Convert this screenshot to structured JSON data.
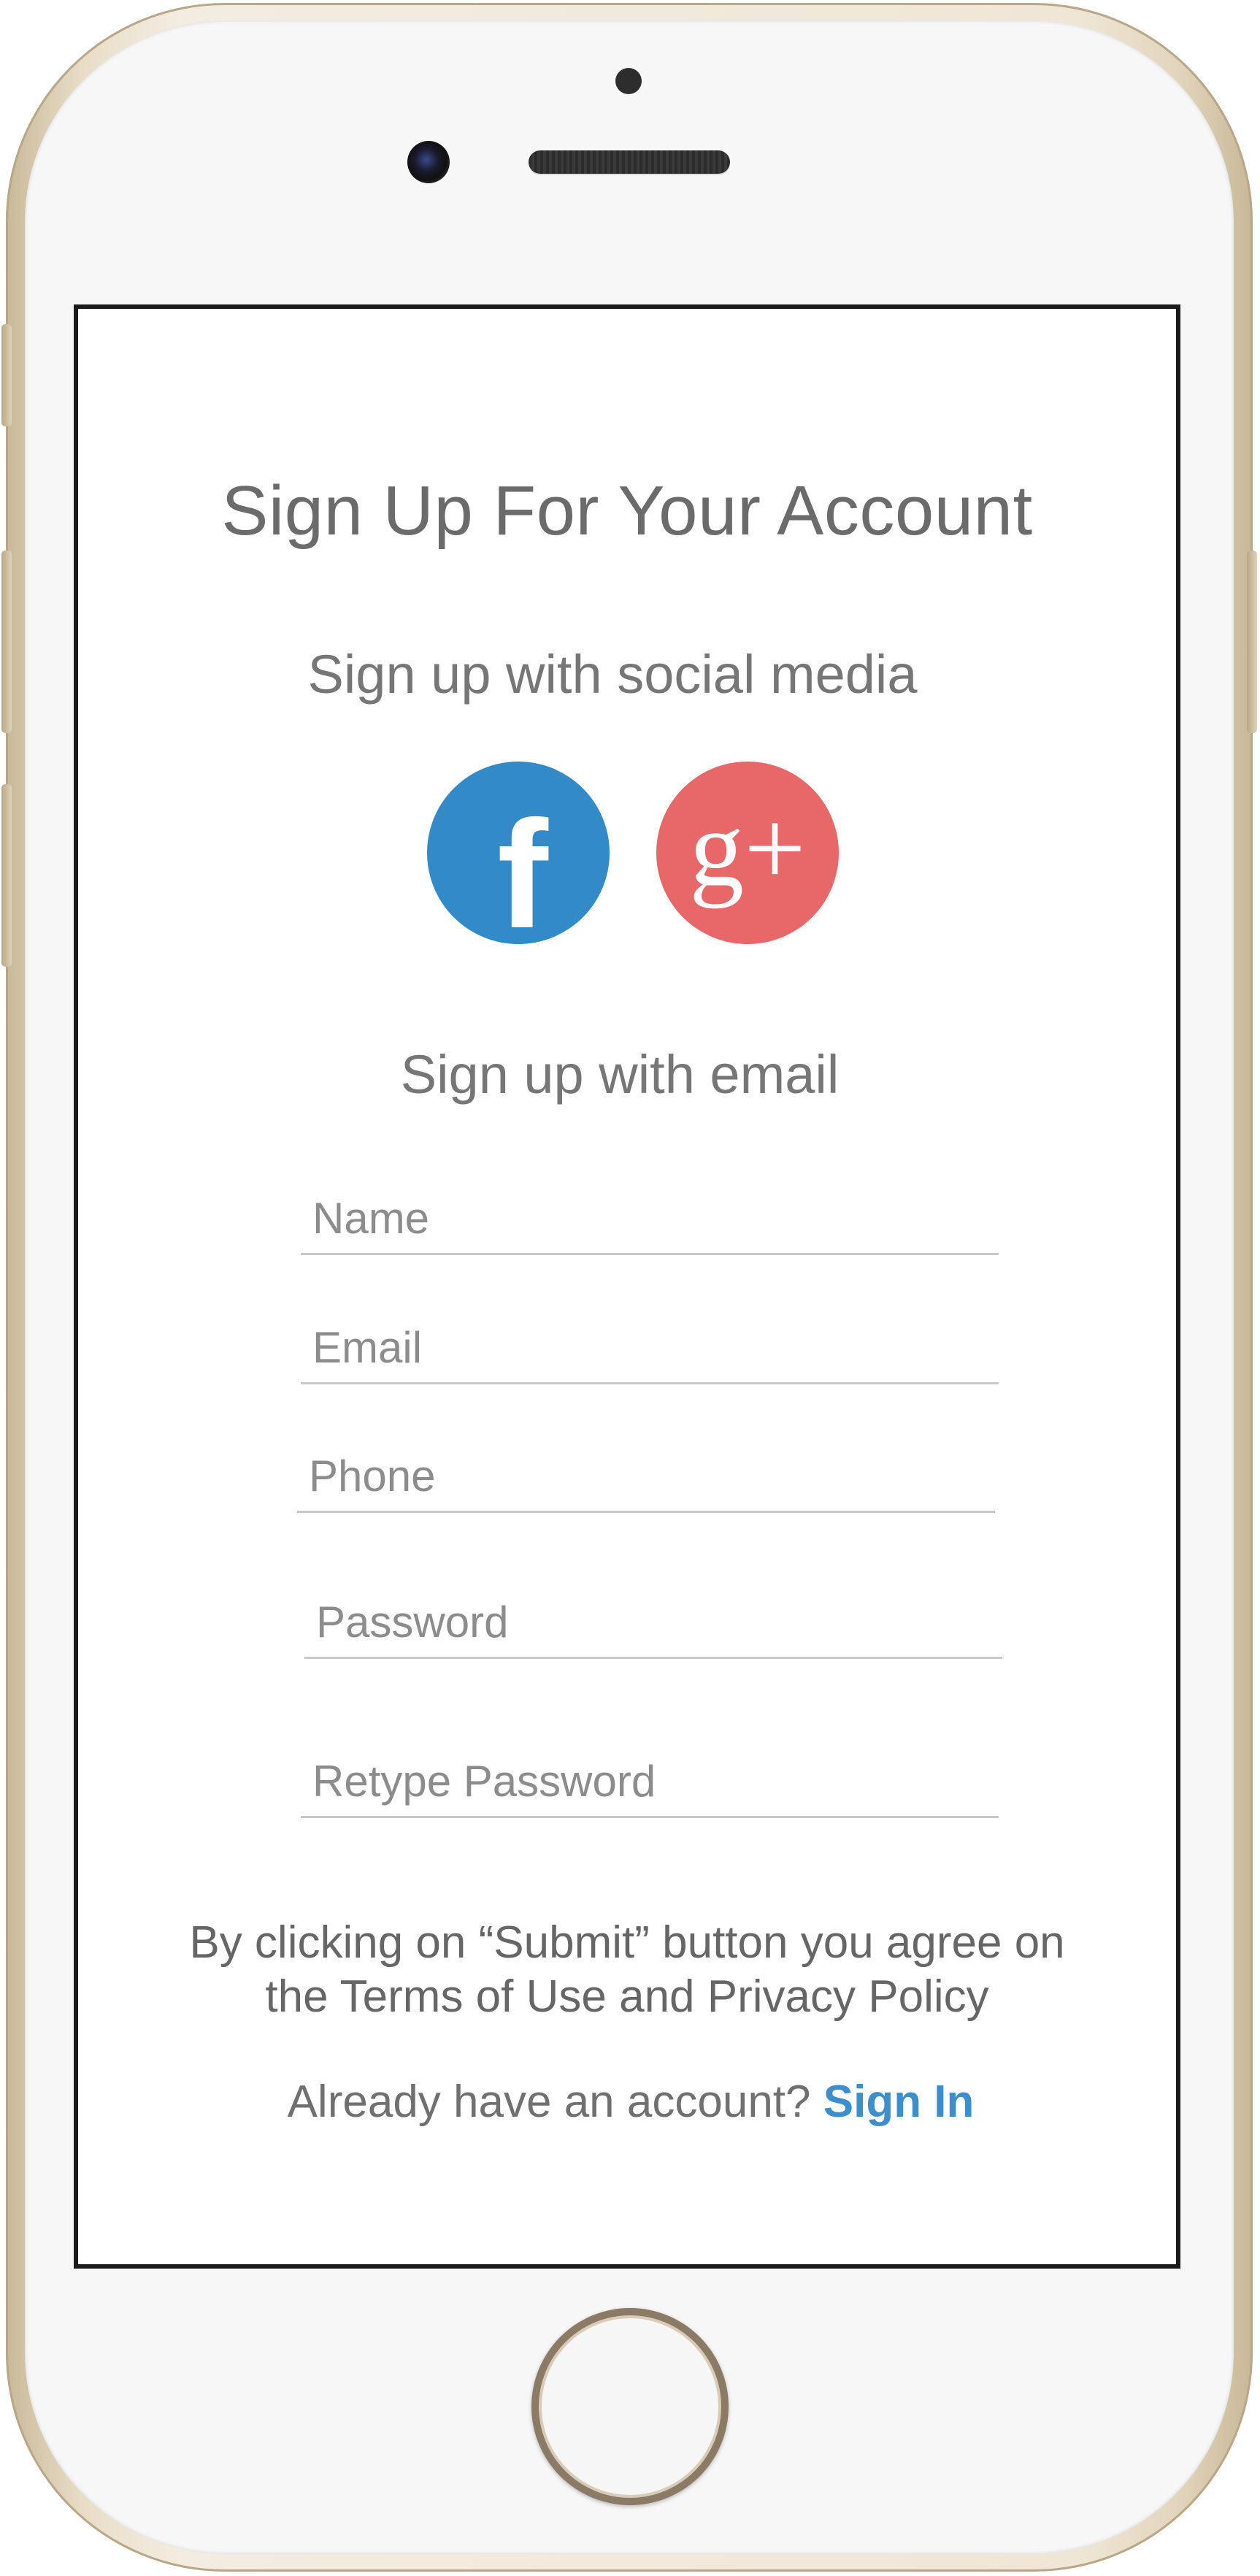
{
  "screen": {
    "title": "Sign Up For Your Account",
    "social_subtitle": "Sign up with social media",
    "social_buttons": [
      {
        "label": "f",
        "icon": "facebook-icon",
        "color": "#338ac8"
      },
      {
        "label": "g+",
        "icon": "google-plus-icon",
        "color": "#e8686a"
      }
    ],
    "email_subtitle": "Sign up with email",
    "fields": {
      "name": {
        "placeholder": "Name",
        "value": ""
      },
      "email": {
        "placeholder": "Email",
        "value": ""
      },
      "phone": {
        "placeholder": "Phone",
        "value": ""
      },
      "password": {
        "placeholder": "Password",
        "value": ""
      },
      "retype_password": {
        "placeholder": "Retype Password",
        "value": ""
      }
    },
    "terms_text": "By clicking on “Submit” button you agree on the Terms of Use and Privacy Policy",
    "signin_prompt": "Already have an account?",
    "signin_link": "Sign In",
    "accent_color": "#3b8fcc"
  },
  "device": {
    "frame_color": "#e8dcc6"
  }
}
